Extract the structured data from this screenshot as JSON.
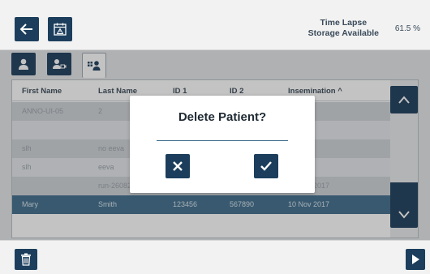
{
  "header": {
    "storage_label_line1": "Time Lapse",
    "storage_label_line2": "Storage Available",
    "storage_value": "61.5 %"
  },
  "table": {
    "columns": [
      "First Name",
      "Last Name",
      "ID 1",
      "ID 2",
      "Insemination ^"
    ],
    "rows": [
      [
        "ANNO-UI-05",
        "2",
        "",
        "",
        "2017"
      ],
      [
        "",
        "",
        "",
        "",
        "2017"
      ],
      [
        "slh",
        "no eeva",
        "",
        "",
        "2017"
      ],
      [
        "slh",
        "eeva",
        "",
        "",
        "2017"
      ],
      [
        "",
        "run-26082015",
        "",
        "",
        "09 Nov 2017"
      ],
      [
        "Mary",
        "Smith",
        "123456",
        "567890",
        "10 Nov 2017"
      ]
    ]
  },
  "dialog": {
    "title": "Delete Patient?"
  },
  "colors": {
    "primary": "#1c3e5c",
    "selected_row": "#3f6d8c"
  },
  "icons": [
    "back-arrow-icon",
    "calendar-alert-icon",
    "patient-icon",
    "patient-video-icon",
    "patient-grid-icon",
    "chevron-up-icon",
    "chevron-down-icon",
    "close-icon",
    "check-icon",
    "trash-icon",
    "play-icon"
  ]
}
